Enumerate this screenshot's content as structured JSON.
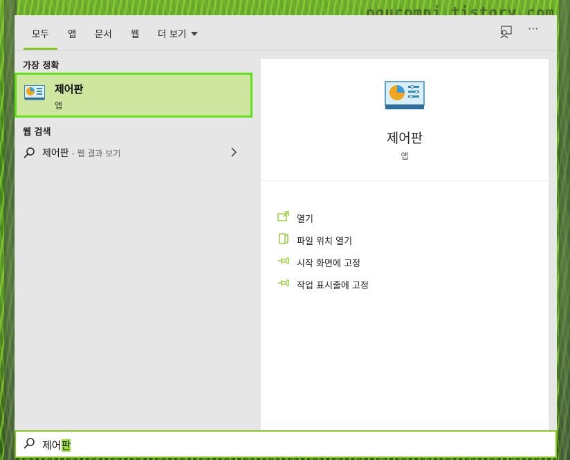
{
  "watermark": "ooucomni.tistory.com",
  "tabs": [
    {
      "label": "모두",
      "active": true
    },
    {
      "label": "앱",
      "active": false
    },
    {
      "label": "문서",
      "active": false
    },
    {
      "label": "웹",
      "active": false
    },
    {
      "label": "더 보기",
      "active": false
    }
  ],
  "toolbar": {
    "feedback_icon": "feedback-icon",
    "more_icon": "ellipsis-icon",
    "more_text": "···"
  },
  "results": {
    "best_match_header": "가장 정확",
    "best_match": {
      "title": "제어판",
      "subtitle": "앱",
      "icon": "control-panel-icon"
    },
    "web_header": "웹 검색",
    "web_item": {
      "query": "제어판",
      "hint": " - 웹 결과 보기"
    }
  },
  "preview": {
    "title": "제어판",
    "type": "앱",
    "actions": [
      {
        "label": "열기",
        "icon": "open-icon"
      },
      {
        "label": "파일 위치 열기",
        "icon": "file-location-icon"
      },
      {
        "label": "시작 화면에 고정",
        "icon": "pin-icon"
      },
      {
        "label": "작업 표시줄에 고정",
        "icon": "pin-icon"
      }
    ]
  },
  "search": {
    "typed": "제어",
    "selected": "판"
  },
  "colors": {
    "accent": "#86c91e",
    "highlight": "#5fe01a",
    "selection": "#9be33b"
  }
}
